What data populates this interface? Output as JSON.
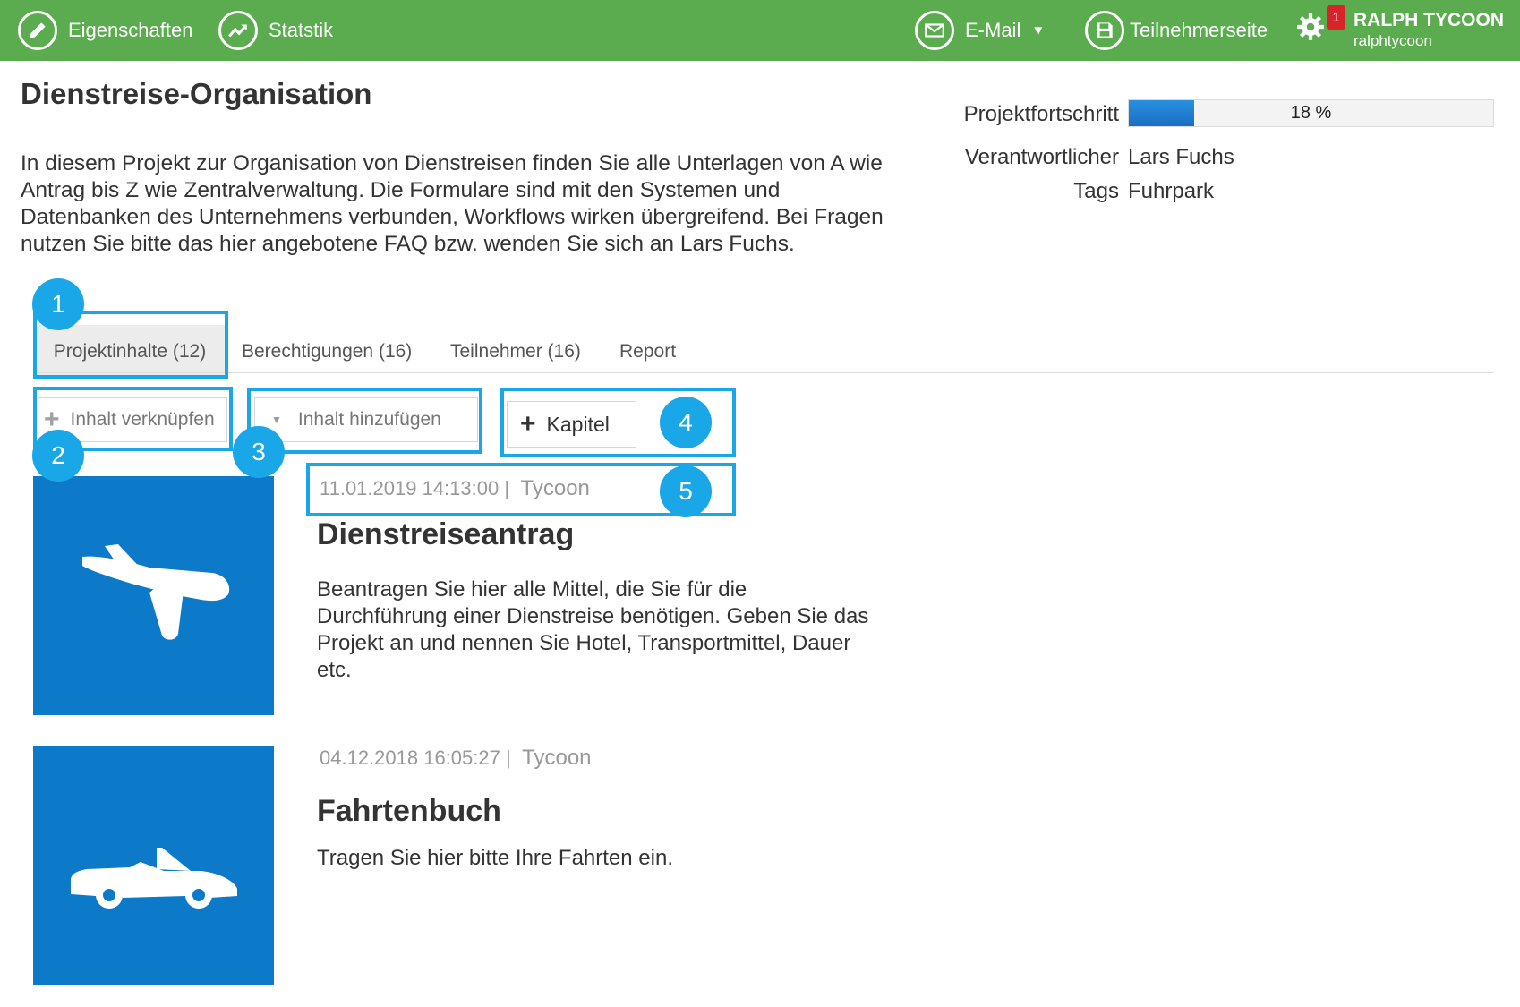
{
  "topbar": {
    "properties_label": "Eigenschaften",
    "stats_label": "Statstik",
    "email_label": "E-Mail",
    "participant_page_label": "Teilnehmerseite",
    "notification_count": "1",
    "user_name": "RALPH TYCOON",
    "user_login": "ralphtycoon"
  },
  "project": {
    "title": "Dienstreise-Organisation",
    "description": "In diesem Projekt zur Organisation von Dienstreisen finden Sie alle Unterlagen von A wie Antrag bis Z wie Zentralverwaltung. Die Formulare sind mit den Systemen und Datenbanken des Unternehmens verbunden,  Workflows wirken übergreifend. Bei Fragen nutzen Sie bitte das hier angebotene FAQ bzw. wenden Sie sich an Lars Fuchs.",
    "progress_label": "Projektfortschritt",
    "progress_value": 0.18,
    "progress_text": "18 %",
    "owner_label": "Verantwortlicher",
    "owner_value": "Lars Fuchs",
    "tags_label": "Tags",
    "tags_value": "Fuhrpark"
  },
  "tabs": [
    {
      "label": "Projektinhalte (12)",
      "active": true
    },
    {
      "label": "Berechtigungen (16)"
    },
    {
      "label": "Teilnehmer (16)"
    },
    {
      "label": "Report"
    }
  ],
  "toolbar": {
    "link_content_label": "Inhalt verknüpfen",
    "add_content_label": "Inhalt hinzufügen",
    "chapter_label": "Kapitel"
  },
  "callouts": [
    "1",
    "2",
    "3",
    "4",
    "5"
  ],
  "items": [
    {
      "timestamp": "11.01.2019 14:13:00 |",
      "author": "Tycoon",
      "title": "Dienstreiseantrag",
      "description": "Beantragen Sie hier alle Mittel, die Sie für die Durchführung einer Dienstreise benötigen. Geben Sie das Projekt an und nennen Sie Hotel, Transportmittel, Dauer etc.",
      "icon": "airplane-icon"
    },
    {
      "timestamp": "04.12.2018 16:05:27 |",
      "author": "Tycoon",
      "title": "Fahrtenbuch",
      "description": "Tragen Sie hier bitte Ihre Fahrten ein.",
      "icon": "car-icon"
    }
  ],
  "colors": {
    "topbar": "#5aac4f",
    "accent": "#1aa7e8",
    "thumb": "#0d79c9",
    "progress": "#1a6fc2"
  }
}
